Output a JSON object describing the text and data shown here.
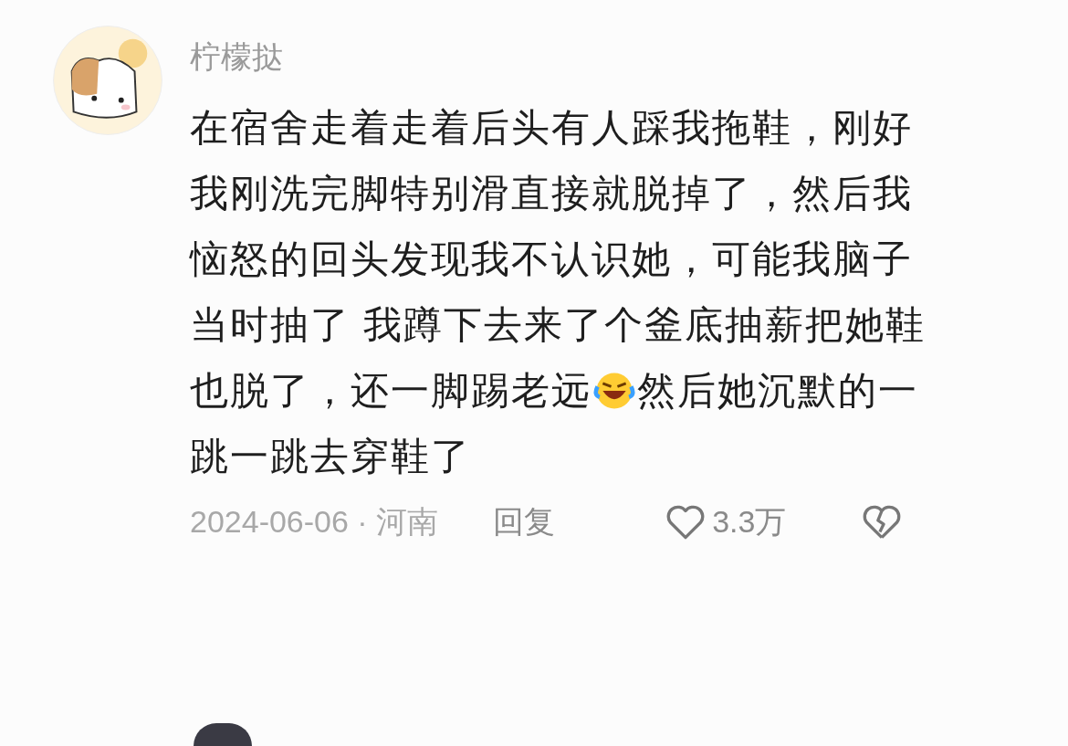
{
  "comment": {
    "username": "柠檬挞",
    "lines": [
      [
        {
          "kind": "text",
          "text": "在宿舍走着走着后头有人踩我拖鞋，刚好"
        }
      ],
      [
        {
          "kind": "text",
          "text": "我刚洗完脚特别滑直接就脱掉了，然后我"
        }
      ],
      [
        {
          "kind": "text",
          "text": "恼怒的回头发现我不认识她，可能我脑子"
        }
      ],
      [
        {
          "kind": "text",
          "text": "当时抽了 我蹲下去来了个釜底抽薪把她鞋"
        }
      ],
      [
        {
          "kind": "text",
          "text": "也脱了，还一脚踢老远"
        },
        {
          "kind": "emoji"
        },
        {
          "kind": "text",
          "text": "然后她沉默的一"
        }
      ],
      [
        {
          "kind": "text",
          "text": "跳一跳去穿鞋了"
        }
      ]
    ],
    "meta": "2024-06-06 · 河南",
    "reply": "回复",
    "likes": "3.3万"
  }
}
